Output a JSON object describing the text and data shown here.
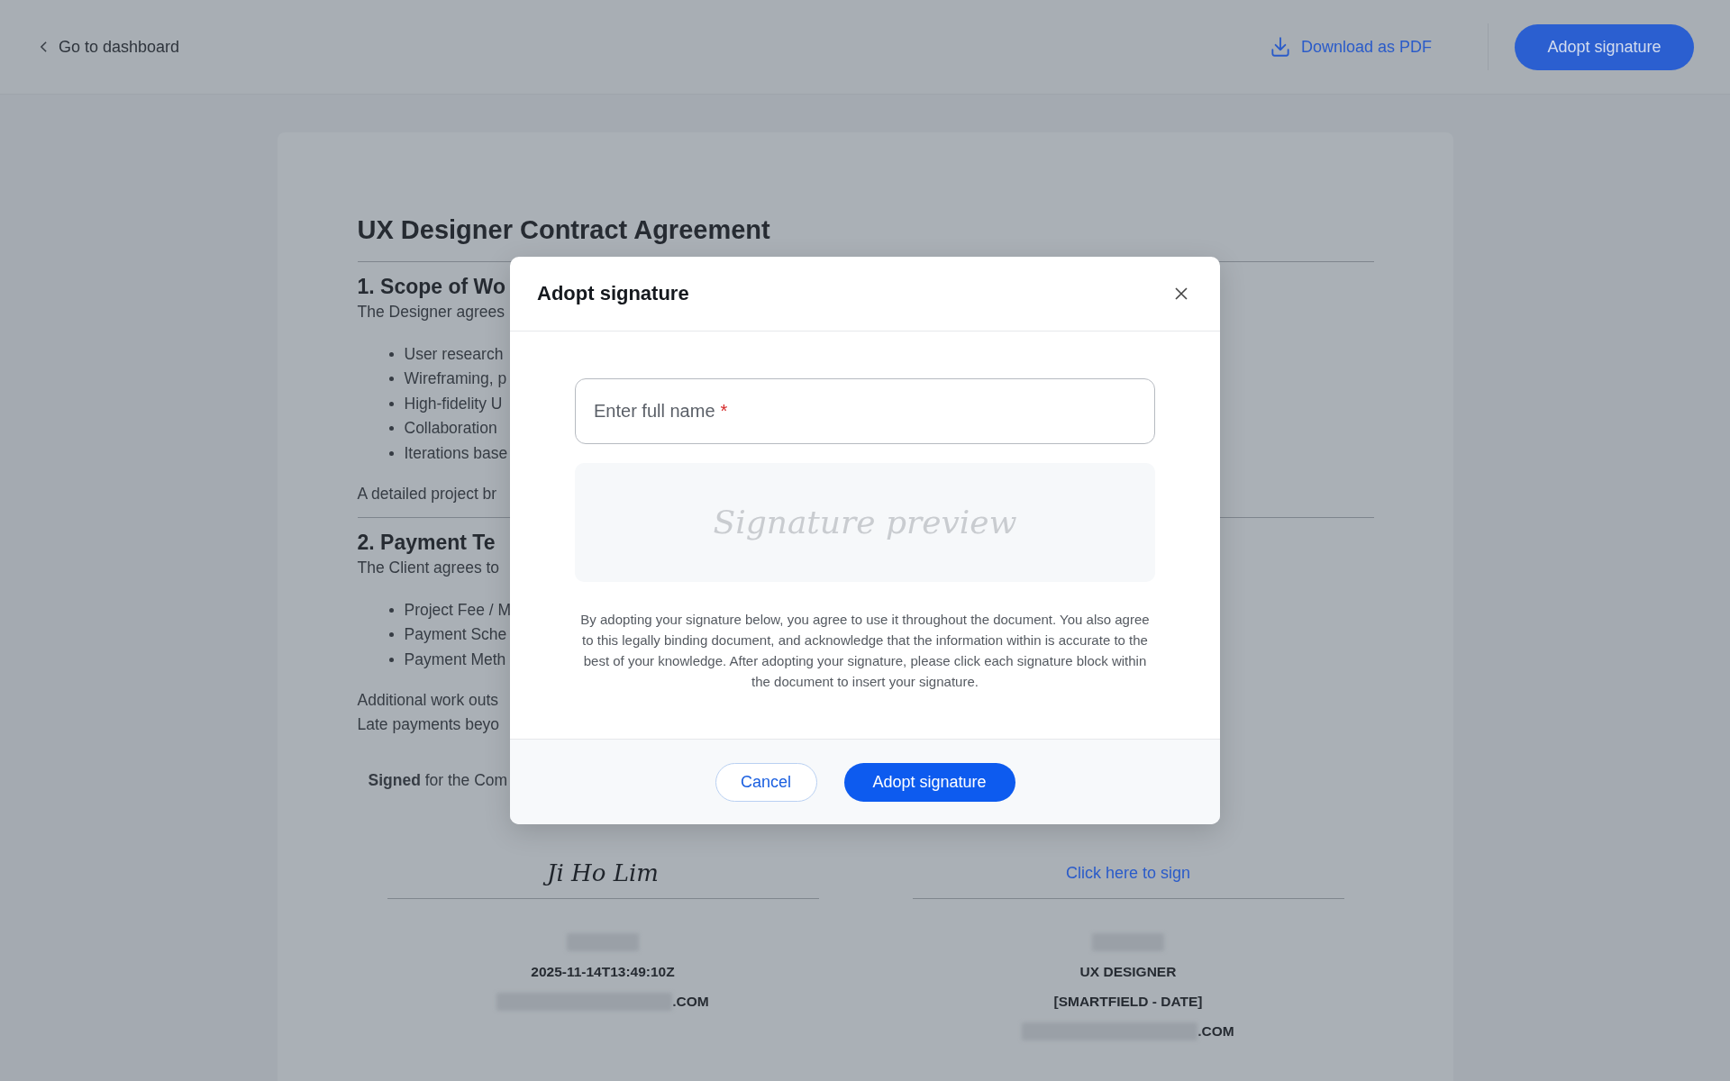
{
  "topbar": {
    "back_link": "Go to dashboard",
    "download_link": "Download as PDF",
    "adopt_button": "Adopt signature"
  },
  "document": {
    "title": "UX Designer Contract Agreement",
    "sections": [
      {
        "heading": "1. Scope of Wo",
        "intro": "The Designer agrees",
        "bullets": [
          "User research",
          "Wireframing, p",
          "High-fidelity U",
          "Collaboration",
          "Iterations base"
        ],
        "closing": [
          "A detailed project br"
        ]
      },
      {
        "heading": "2. Payment Te",
        "intro": "The Client agrees to",
        "bullets": [
          "Project Fee / M",
          "Payment Sche",
          "Payment Meth"
        ],
        "closing": [
          "Additional work outs",
          "Late payments beyo"
        ]
      }
    ],
    "signed_line": "**Signed** for the Com",
    "signatures": [
      {
        "kind": "signed",
        "signature": "Ji Ho Lim",
        "lines": [
          {
            "kind": "redacted"
          },
          {
            "kind": "text",
            "text": "2025-11-14T13:49:10Z"
          },
          {
            "kind": "email",
            "suffix": ".COM"
          }
        ]
      },
      {
        "kind": "unsigned",
        "link": "Click here to sign",
        "lines": [
          {
            "kind": "redacted"
          },
          {
            "kind": "text",
            "text": "UX DESIGNER"
          },
          {
            "kind": "text",
            "text": "[SMARTFIELD - DATE]"
          },
          {
            "kind": "email",
            "suffix": ".COM"
          }
        ]
      }
    ]
  },
  "modal": {
    "title": "Adopt signature",
    "name_field": {
      "placeholder": "Enter full name",
      "required_mark": "*"
    },
    "preview_placeholder": "Signature preview",
    "disclaimer": "By adopting your signature below, you agree to use it throughout the document. You also agree to this legally binding document, and acknowledge that the information within is accurate to the best of your knowledge. After adopting your signature, please click each signature block within the document to insert your signature.",
    "cancel_button": "Cancel",
    "adopt_button": "Adopt signature"
  }
}
